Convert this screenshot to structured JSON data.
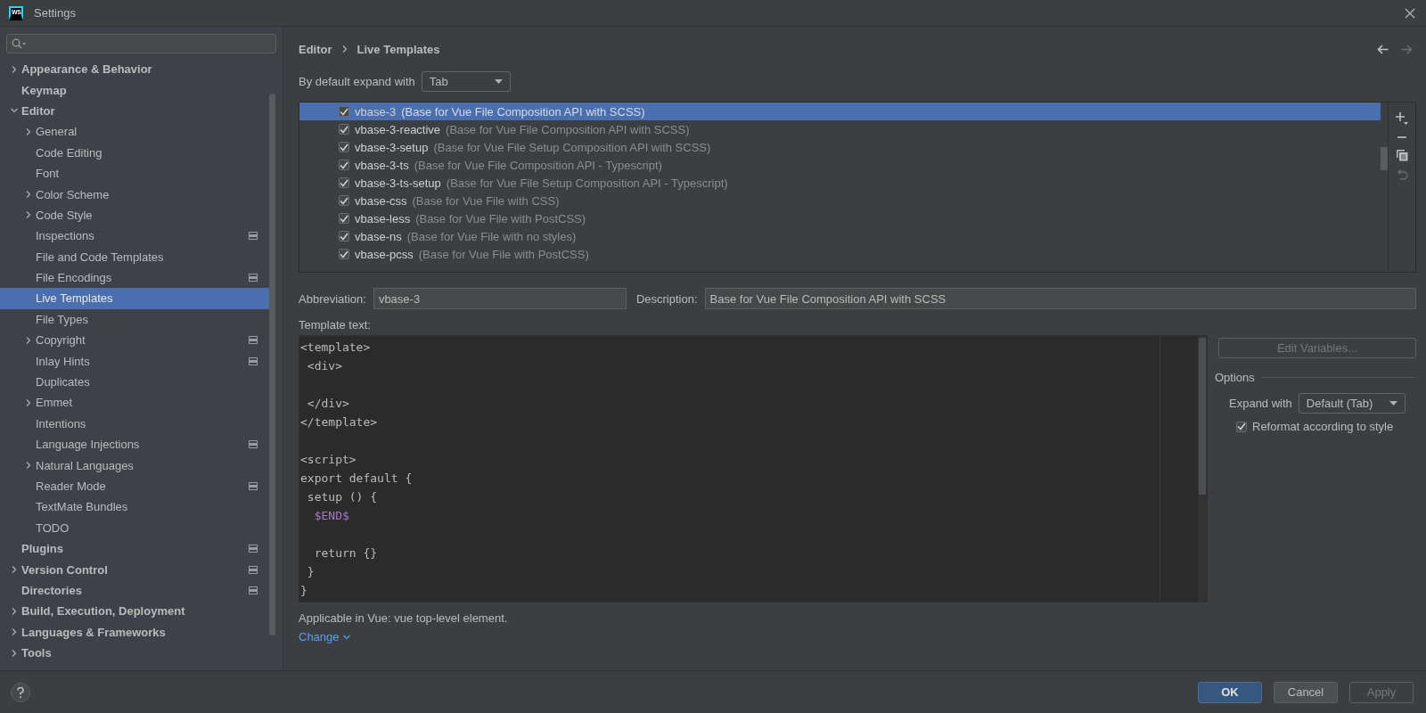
{
  "window": {
    "logo": "WS",
    "title": "Settings"
  },
  "sidebar": {
    "items": [
      {
        "label": "Appearance & Behavior",
        "kind": "folder",
        "expanded": false,
        "selected": false,
        "shows_icon": false
      },
      {
        "label": "Keymap",
        "kind": "leaf",
        "selected": false,
        "shows_icon": false
      },
      {
        "label": "Editor",
        "kind": "folder",
        "expanded": true,
        "selected": false,
        "shows_icon": false,
        "children": [
          {
            "label": "General",
            "kind": "folder",
            "expanded": false,
            "selected": false,
            "shows_icon": false
          },
          {
            "label": "Code Editing",
            "kind": "leaf",
            "selected": false,
            "shows_icon": false
          },
          {
            "label": "Font",
            "kind": "leaf",
            "selected": false,
            "shows_icon": false
          },
          {
            "label": "Color Scheme",
            "kind": "folder",
            "expanded": false,
            "selected": false,
            "shows_icon": false
          },
          {
            "label": "Code Style",
            "kind": "folder",
            "expanded": false,
            "selected": false,
            "shows_icon": false
          },
          {
            "label": "Inspections",
            "kind": "leaf",
            "selected": false,
            "shows_icon": true
          },
          {
            "label": "File and Code Templates",
            "kind": "leaf",
            "selected": false,
            "shows_icon": false
          },
          {
            "label": "File Encodings",
            "kind": "leaf",
            "selected": false,
            "shows_icon": true
          },
          {
            "label": "Live Templates",
            "kind": "leaf",
            "selected": true,
            "shows_icon": false
          },
          {
            "label": "File Types",
            "kind": "leaf",
            "selected": false,
            "shows_icon": false
          },
          {
            "label": "Copyright",
            "kind": "folder",
            "expanded": false,
            "selected": false,
            "shows_icon": true
          },
          {
            "label": "Inlay Hints",
            "kind": "leaf",
            "selected": false,
            "shows_icon": true
          },
          {
            "label": "Duplicates",
            "kind": "leaf",
            "selected": false,
            "shows_icon": false
          },
          {
            "label": "Emmet",
            "kind": "folder",
            "expanded": false,
            "selected": false,
            "shows_icon": false
          },
          {
            "label": "Intentions",
            "kind": "leaf",
            "selected": false,
            "shows_icon": false
          },
          {
            "label": "Language Injections",
            "kind": "leaf",
            "selected": false,
            "shows_icon": true
          },
          {
            "label": "Natural Languages",
            "kind": "folder",
            "expanded": false,
            "selected": false,
            "shows_icon": false
          },
          {
            "label": "Reader Mode",
            "kind": "leaf",
            "selected": false,
            "shows_icon": true
          },
          {
            "label": "TextMate Bundles",
            "kind": "leaf",
            "selected": false,
            "shows_icon": false
          },
          {
            "label": "TODO",
            "kind": "leaf",
            "selected": false,
            "shows_icon": false
          }
        ]
      },
      {
        "label": "Plugins",
        "kind": "leaf",
        "selected": false,
        "shows_icon": true
      },
      {
        "label": "Version Control",
        "kind": "folder",
        "expanded": false,
        "selected": false,
        "shows_icon": true
      },
      {
        "label": "Directories",
        "kind": "leaf",
        "selected": false,
        "shows_icon": true
      },
      {
        "label": "Build, Execution, Deployment",
        "kind": "folder",
        "expanded": false,
        "selected": false,
        "shows_icon": false
      },
      {
        "label": "Languages & Frameworks",
        "kind": "folder",
        "expanded": false,
        "selected": false,
        "shows_icon": false
      },
      {
        "label": "Tools",
        "kind": "folder",
        "expanded": false,
        "selected": false,
        "shows_icon": false
      }
    ]
  },
  "breadcrumb": [
    "Editor",
    "Live Templates"
  ],
  "expand_default": {
    "label": "By default expand with",
    "value": "Tab"
  },
  "templates": [
    {
      "abbreviation": "vbase-3",
      "description": "(Base for Vue File Composition API with SCSS)",
      "checked": true,
      "selected": true
    },
    {
      "abbreviation": "vbase-3-reactive",
      "description": "(Base for Vue File Composition API with SCSS)",
      "checked": true,
      "selected": false
    },
    {
      "abbreviation": "vbase-3-setup",
      "description": "(Base for Vue File Setup Composition API with SCSS)",
      "checked": true,
      "selected": false
    },
    {
      "abbreviation": "vbase-3-ts",
      "description": "(Base for Vue File Composition API - Typescript)",
      "checked": true,
      "selected": false
    },
    {
      "abbreviation": "vbase-3-ts-setup",
      "description": "(Base for Vue File Setup Composition API - Typescript)",
      "checked": true,
      "selected": false
    },
    {
      "abbreviation": "vbase-css",
      "description": "(Base for Vue File with CSS)",
      "checked": true,
      "selected": false
    },
    {
      "abbreviation": "vbase-less",
      "description": "(Base for Vue File with PostCSS)",
      "checked": true,
      "selected": false
    },
    {
      "abbreviation": "vbase-ns",
      "description": "(Base for Vue File with no styles)",
      "checked": true,
      "selected": false
    },
    {
      "abbreviation": "vbase-pcss",
      "description": "(Base for Vue File with PostCSS)",
      "checked": true,
      "selected": false
    }
  ],
  "abbreviation": {
    "label": "Abbreviation:",
    "value": "vbase-3"
  },
  "description": {
    "label": "Description:",
    "value": "Base for Vue File Composition API with SCSS"
  },
  "template_text": {
    "label": "Template text:",
    "lines": [
      {
        "text": "<template>",
        "kind": "code"
      },
      {
        "text": " <div>",
        "kind": "code"
      },
      {
        "kind": "blank"
      },
      {
        "text": " </div>",
        "kind": "code"
      },
      {
        "text": "</template>",
        "kind": "code"
      },
      {
        "kind": "blank"
      },
      {
        "text": "<script>",
        "kind": "code"
      },
      {
        "text": "export default {",
        "kind": "code"
      },
      {
        "text": " setup () {",
        "kind": "code"
      },
      {
        "text": "  $END$",
        "kind": "variable"
      },
      {
        "kind": "blank"
      },
      {
        "text": "  return {}",
        "kind": "code"
      },
      {
        "text": " }",
        "kind": "code"
      },
      {
        "text": "}",
        "kind": "code"
      }
    ]
  },
  "edit_variables_button": {
    "label": "Edit Variables...",
    "disabled": true
  },
  "options": {
    "title": "Options",
    "expand_with": {
      "label": "Expand with",
      "value": "Default (Tab)"
    },
    "reformat": {
      "label": "Reformat according to style",
      "checked": true
    }
  },
  "applicable": "Applicable in Vue: vue top-level element.",
  "change_link": "Change",
  "buttons": [
    {
      "label": "OK",
      "kind": "primary",
      "disabled": false
    },
    {
      "label": "Cancel",
      "kind": "normal",
      "disabled": false
    },
    {
      "label": "Apply",
      "kind": "normal",
      "disabled": true
    }
  ]
}
